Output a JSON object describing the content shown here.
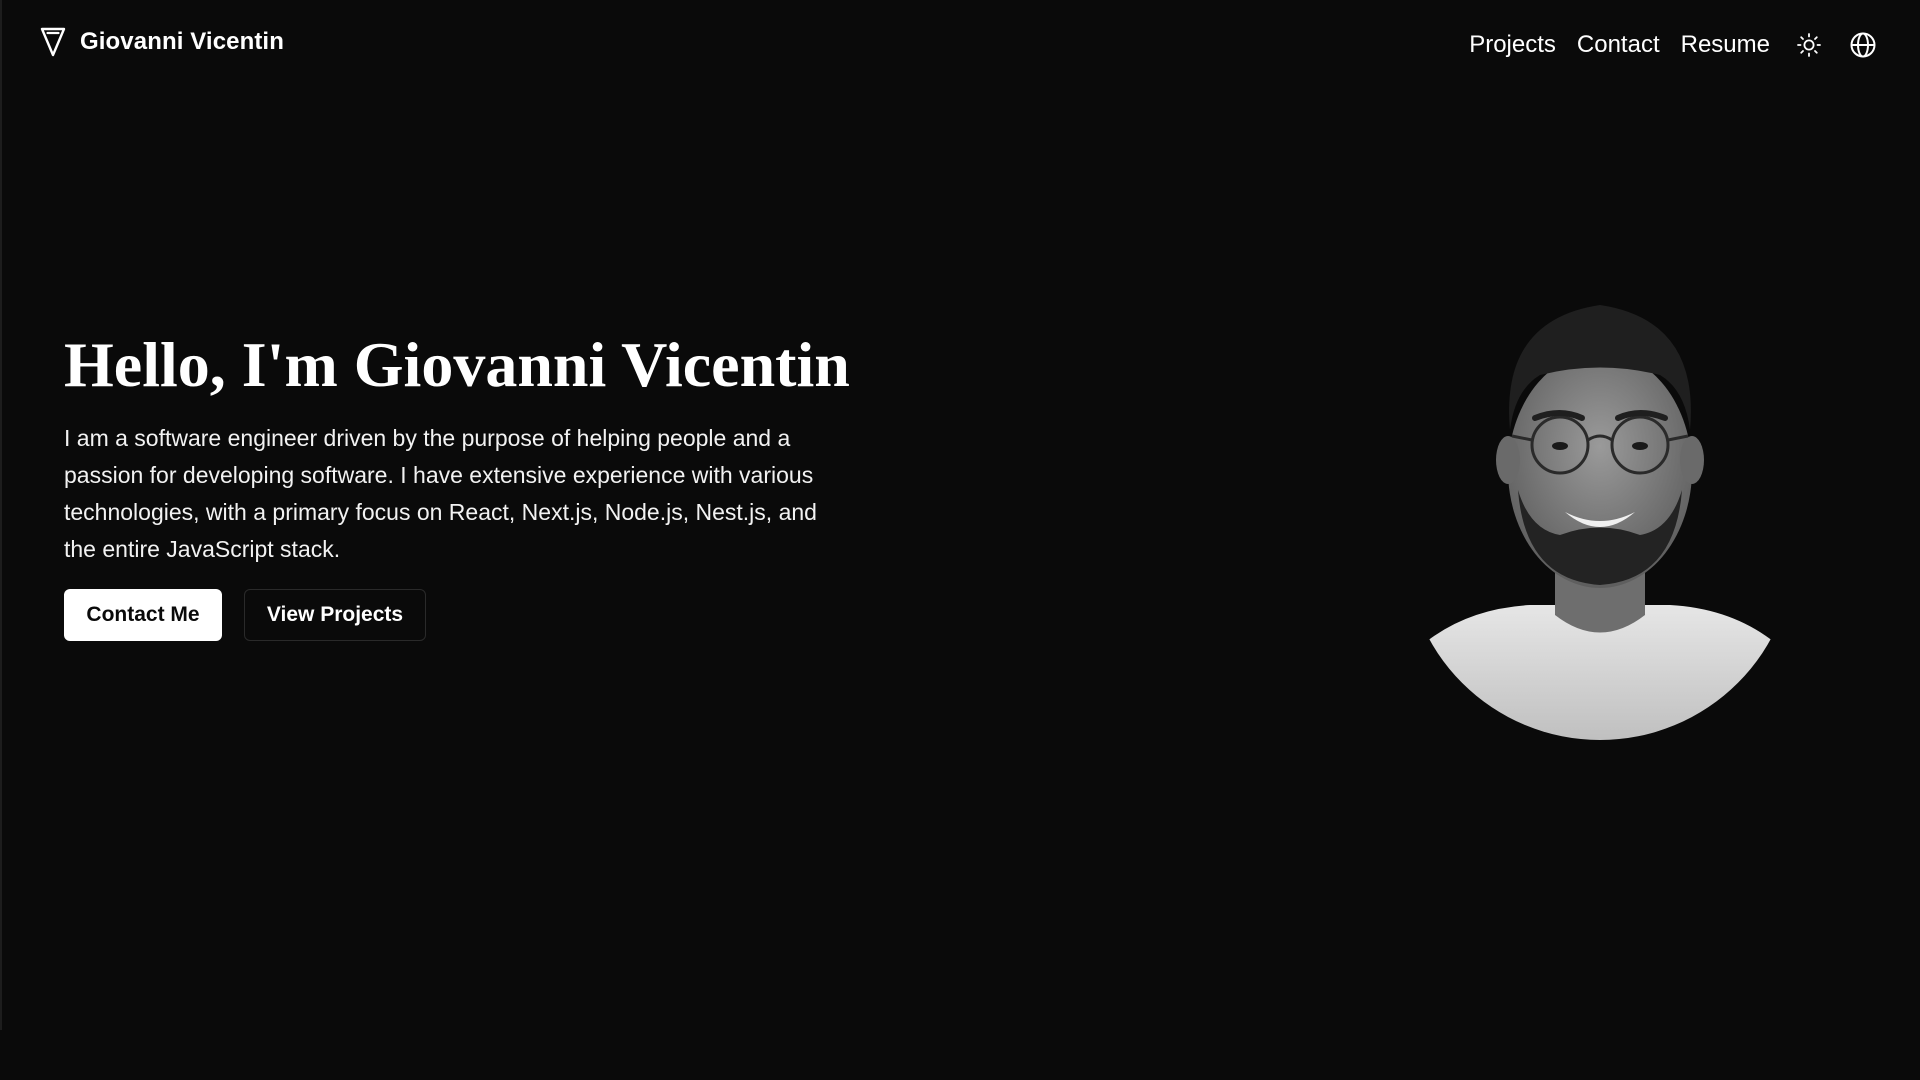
{
  "header": {
    "brand_name": "Giovanni Vicentin",
    "nav": [
      {
        "label": "Projects"
      },
      {
        "label": "Contact"
      },
      {
        "label": "Resume"
      }
    ],
    "icons": [
      "sun-icon",
      "globe-icon"
    ]
  },
  "hero": {
    "title": "Hello, I'm Giovanni Vicentin",
    "description": "I am a software engineer driven by the purpose of helping people and a passion for developing software. I have extensive experience with various technologies, with a primary focus on React, Next.js, Node.js, Nest.js, and the entire JavaScript stack.",
    "primary_button": "Contact Me",
    "secondary_button": "View Projects"
  },
  "colors": {
    "background": "#0a0a0a",
    "text": "#ffffff",
    "primary_button_bg": "#ffffff",
    "primary_button_text": "#0a0a0a",
    "secondary_border": "#2a2a2a"
  }
}
